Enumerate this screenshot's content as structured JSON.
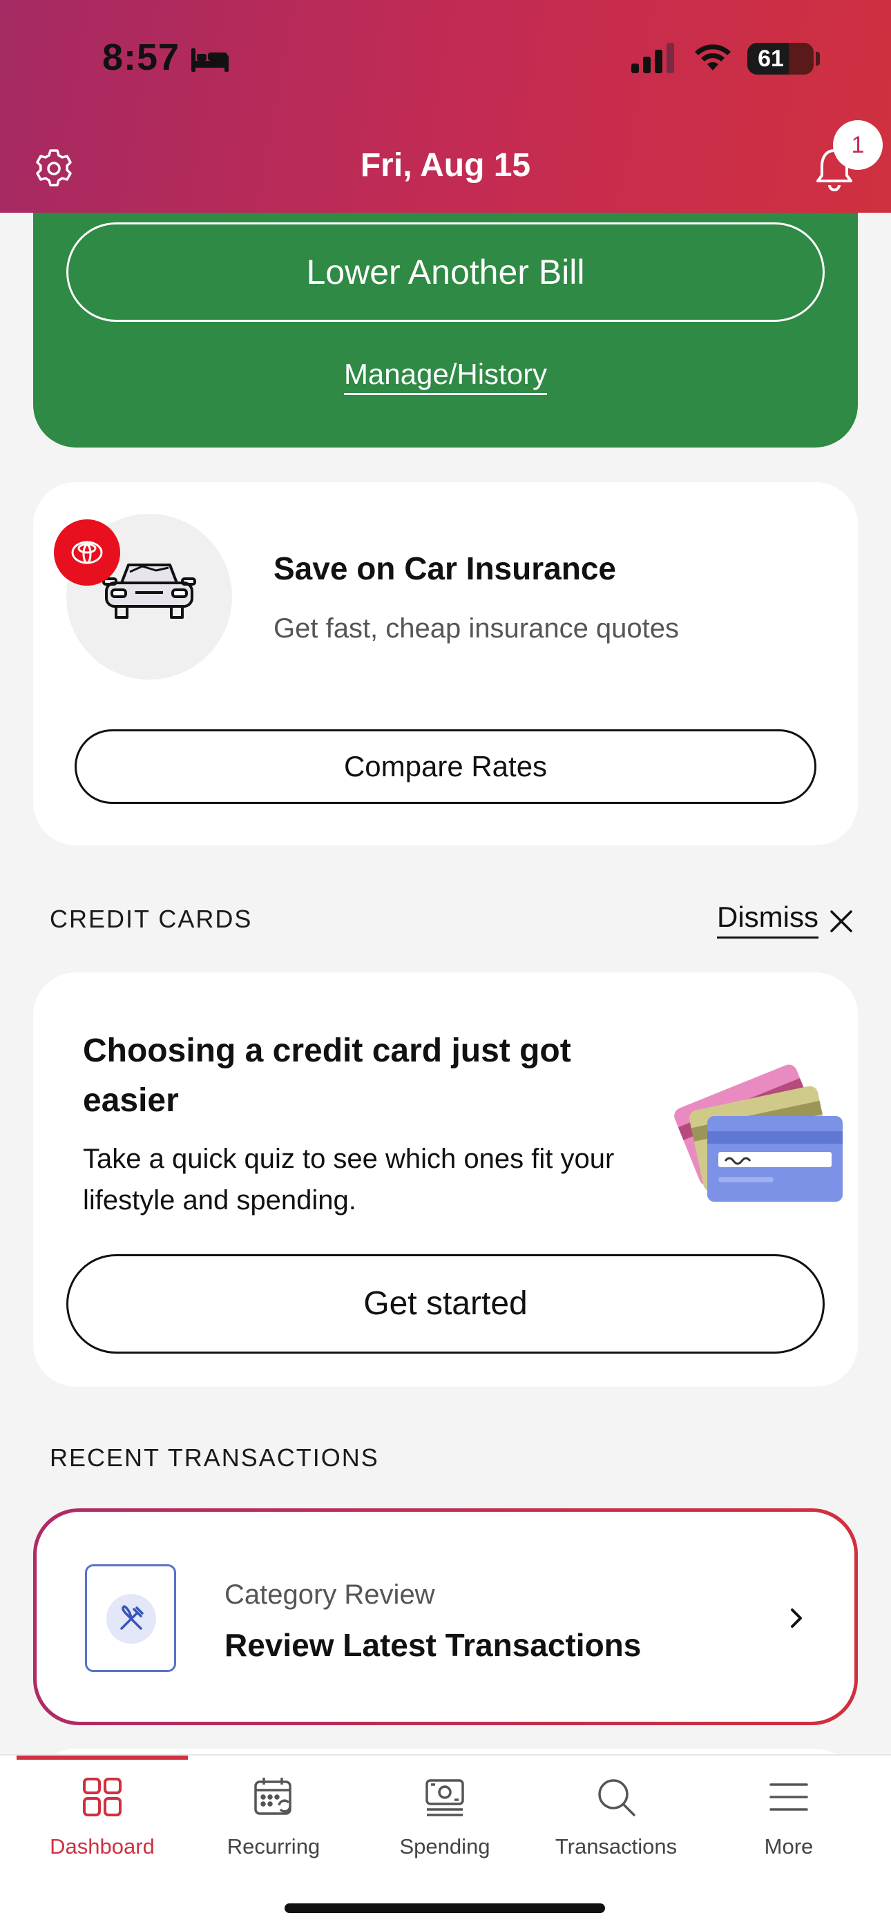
{
  "status_bar": {
    "time": "8:57",
    "battery": "61",
    "icons": [
      "bed-icon",
      "signal-icon",
      "wifi-icon",
      "battery-icon"
    ]
  },
  "header": {
    "date": "Fri, Aug 15",
    "notification_count": "1",
    "gradient_colors": [
      "#a52a63",
      "#d0303f"
    ]
  },
  "bill_card": {
    "button_label": "Lower Another Bill",
    "link_label": "Manage/History",
    "background": "#2e8a44"
  },
  "insurance_card": {
    "title": "Save on Car Insurance",
    "subtitle": "Get fast, cheap insurance quotes",
    "button_label": "Compare Rates",
    "badge_color": "#e8101e"
  },
  "credit_cards": {
    "section_label": "CREDIT CARDS",
    "dismiss_label": "Dismiss",
    "title": "Choosing a credit card just got easier",
    "description": "Take a quick quiz to see which ones fit your lifestyle and spending.",
    "button_label": "Get started"
  },
  "recent_transactions": {
    "section_label": "RECENT TRANSACTIONS",
    "review_label": "Category Review",
    "review_title": "Review Latest Transactions"
  },
  "tabs": [
    {
      "label": "Dashboard",
      "icon": "dashboard-icon",
      "active": true
    },
    {
      "label": "Recurring",
      "icon": "recurring-calendar-icon",
      "active": false
    },
    {
      "label": "Spending",
      "icon": "spending-money-icon",
      "active": false
    },
    {
      "label": "Transactions",
      "icon": "search-icon",
      "active": false
    },
    {
      "label": "More",
      "icon": "menu-icon",
      "active": false
    }
  ],
  "accent_color": "#d0303f"
}
